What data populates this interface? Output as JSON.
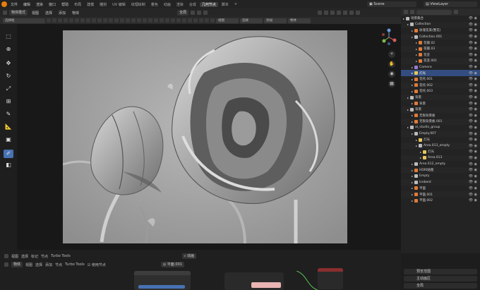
{
  "topbar": {
    "menus": [
      "文件",
      "编辑",
      "渲染",
      "窗口",
      "帮助"
    ],
    "tabs": [
      "布局",
      "建模",
      "雕刻",
      "UV 编辑",
      "纹理绘制",
      "着色",
      "动画",
      "渲染",
      "合成",
      "几何节点",
      "脚本"
    ],
    "active_tab": "几何节点",
    "scene": "Scene",
    "view_layer": "ViewLayer"
  },
  "header": {
    "mode": "物体模式",
    "menus": [
      "视图",
      "选择",
      "添加",
      "物体"
    ],
    "orientation": "全局"
  },
  "toolheader": {
    "snap_label": "选择框",
    "fields": [
      "视图",
      "选择",
      "添加",
      "物体"
    ]
  },
  "outliner": {
    "title": "场景集合",
    "rows": [
      {
        "label": "场景集合",
        "indent": 0,
        "color": "#bbbbbb"
      },
      {
        "label": "Collection",
        "indent": 1,
        "color": "#bbbbbb"
      },
      {
        "label": "玫瑰花束(整花)",
        "indent": 2,
        "color": "#e07b39"
      },
      {
        "label": "Collection.001",
        "indent": 2,
        "color": "#bbbbbb"
      },
      {
        "label": "花瓣.02",
        "indent": 3,
        "color": "#e07b39"
      },
      {
        "label": "花瓣.03",
        "indent": 3,
        "color": "#e07b39"
      },
      {
        "label": "花茎",
        "indent": 3,
        "color": "#e07b39"
      },
      {
        "label": "花茎.001",
        "indent": 3,
        "color": "#e07b39"
      },
      {
        "label": "Camera",
        "indent": 2,
        "color": "#9c7bd4"
      },
      {
        "label": "灯光",
        "indent": 2,
        "color": "#e6c65c"
      },
      {
        "label": "花托.001",
        "indent": 2,
        "color": "#e07b39"
      },
      {
        "label": "花托.002",
        "indent": 2,
        "color": "#e07b39"
      },
      {
        "label": "花托.003",
        "indent": 2,
        "color": "#e07b39"
      },
      {
        "label": "背景",
        "indent": 1,
        "color": "#bbbbbb"
      },
      {
        "label": "背景",
        "indent": 2,
        "color": "#e07b39"
      },
      {
        "label": "背景",
        "indent": 1,
        "color": "#bbbbbb"
      },
      {
        "label": "无限背景板",
        "indent": 2,
        "color": "#e07b39"
      },
      {
        "label": "无限背景板.001",
        "indent": 2,
        "color": "#e07b39"
      },
      {
        "label": "al_studio_group",
        "indent": 1,
        "color": "#bbbbbb"
      },
      {
        "label": "Empty.007",
        "indent": 2,
        "color": "#bbbbbb"
      },
      {
        "label": "灯光",
        "indent": 3,
        "color": "#e6c65c"
      },
      {
        "label": "Area.013_empty",
        "indent": 3,
        "color": "#bbbbbb"
      },
      {
        "label": "灯光",
        "indent": 4,
        "color": "#e6c65c"
      },
      {
        "label": "Area.013",
        "indent": 4,
        "color": "#e6c65c"
      },
      {
        "label": "Area.012_empty",
        "indent": 2,
        "color": "#bbbbbb"
      },
      {
        "label": "HDRI贴图",
        "indent": 2,
        "color": "#e07b39"
      },
      {
        "label": "Empty",
        "indent": 2,
        "color": "#bbbbbb"
      },
      {
        "label": "Icebent",
        "indent": 2,
        "color": "#bbbbbb"
      },
      {
        "label": "平面",
        "indent": 2,
        "color": "#e07b39"
      },
      {
        "label": "平面.001",
        "indent": 2,
        "color": "#e07b39"
      },
      {
        "label": "平面.002",
        "indent": 2,
        "color": "#e07b39"
      }
    ],
    "selected_index": 9
  },
  "timeline": {
    "menus": [
      "视图",
      "选择",
      "标记",
      "节点"
    ],
    "node_label": "Turbo Tools",
    "frame_field": "动画",
    "row2": [
      "物体",
      "视图",
      "选择",
      "添加",
      "节点",
      "Turbo Tools",
      "使用节点"
    ],
    "node_name": "平面.001",
    "node_sub": "平面.001"
  },
  "props": {
    "rows": [
      "预览范围",
      "主动画区",
      "全局"
    ]
  }
}
